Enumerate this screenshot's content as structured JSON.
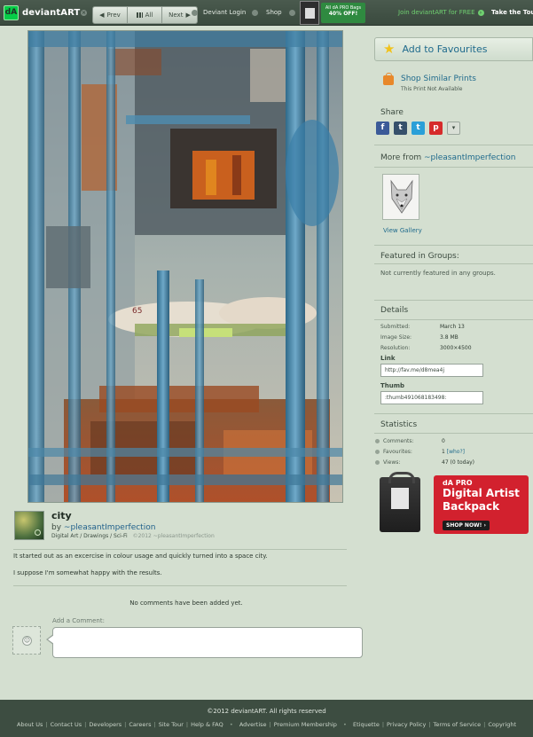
{
  "topbar": {
    "logo_text": "deviantART",
    "prev_label": "Prev",
    "all_label": "All",
    "next_label": "Next",
    "login_label": "Deviant Login",
    "shop_label": "Shop",
    "promo_line1": "All dA PRO Bags",
    "promo_line2": "40% OFF!",
    "join_label": "Join deviantART for FREE",
    "tour_label": "Take the Tour"
  },
  "deviation": {
    "title": "city",
    "by_prefix": "by ",
    "author": "~pleasantImperfection",
    "categories": "Digital Art / Drawings / Sci-Fi",
    "copyright": "©2012 ~pleasantImperfection",
    "description_1": "It started out as an excercise in colour usage and quickly turned into a space city.",
    "description_2": "I suppose I'm somewhat happy with the results."
  },
  "comments": {
    "empty_text": "No comments have been added yet.",
    "add_label": "Add a Comment:",
    "placeholder": ""
  },
  "sidebar": {
    "favourite_label": "Add to Favourites",
    "shop_similar_label": "Shop Similar Prints",
    "shop_similar_sub": "This Print Not Available",
    "share_heading": "Share",
    "more_from_prefix": "More from ",
    "more_from_author": "~pleasantImperfection",
    "view_gallery": "View Gallery",
    "groups_heading": "Featured in Groups:",
    "groups_text": "Not currently featured in any groups.",
    "details_heading": "Details",
    "details": [
      {
        "label": "Submitted:",
        "value": "March 13"
      },
      {
        "label": "Image Size:",
        "value": "3.8 MB"
      },
      {
        "label": "Resolution:",
        "value": "3000×4500"
      }
    ],
    "link_label": "Link",
    "link_value": "http://fav.me/d8mea4j",
    "thumb_label": "Thumb",
    "thumb_value": ":thumb491068183498:",
    "statistics_heading": "Statistics",
    "stats": {
      "comments_label": "Comments:",
      "comments_value": "0",
      "favourites_label": "Favourites:",
      "favourites_value": "1",
      "favourites_who": "[who?]",
      "views_label": "Views:",
      "views_value": "47 (0 today)"
    }
  },
  "ad": {
    "pre": "dA PRO",
    "line1": "Digital Artist",
    "line2": "Backpack",
    "cta": "SHOP NOW! ›"
  },
  "footer": {
    "copyright": "©2012 deviantART. All rights reserved",
    "links": [
      "About Us",
      "Contact Us",
      "Developers",
      "Careers",
      "Site Tour",
      "Help & FAQ",
      "Advertise",
      "Premium Membership",
      "Etiquette",
      "Privacy Policy",
      "Terms of Service",
      "Copyright"
    ]
  },
  "colors": {
    "background": "#d4dfd0",
    "topbar": "#3a4a3e",
    "link": "#1f6a8c",
    "accent_green": "#05cc47",
    "ad_red": "#d2212e"
  }
}
